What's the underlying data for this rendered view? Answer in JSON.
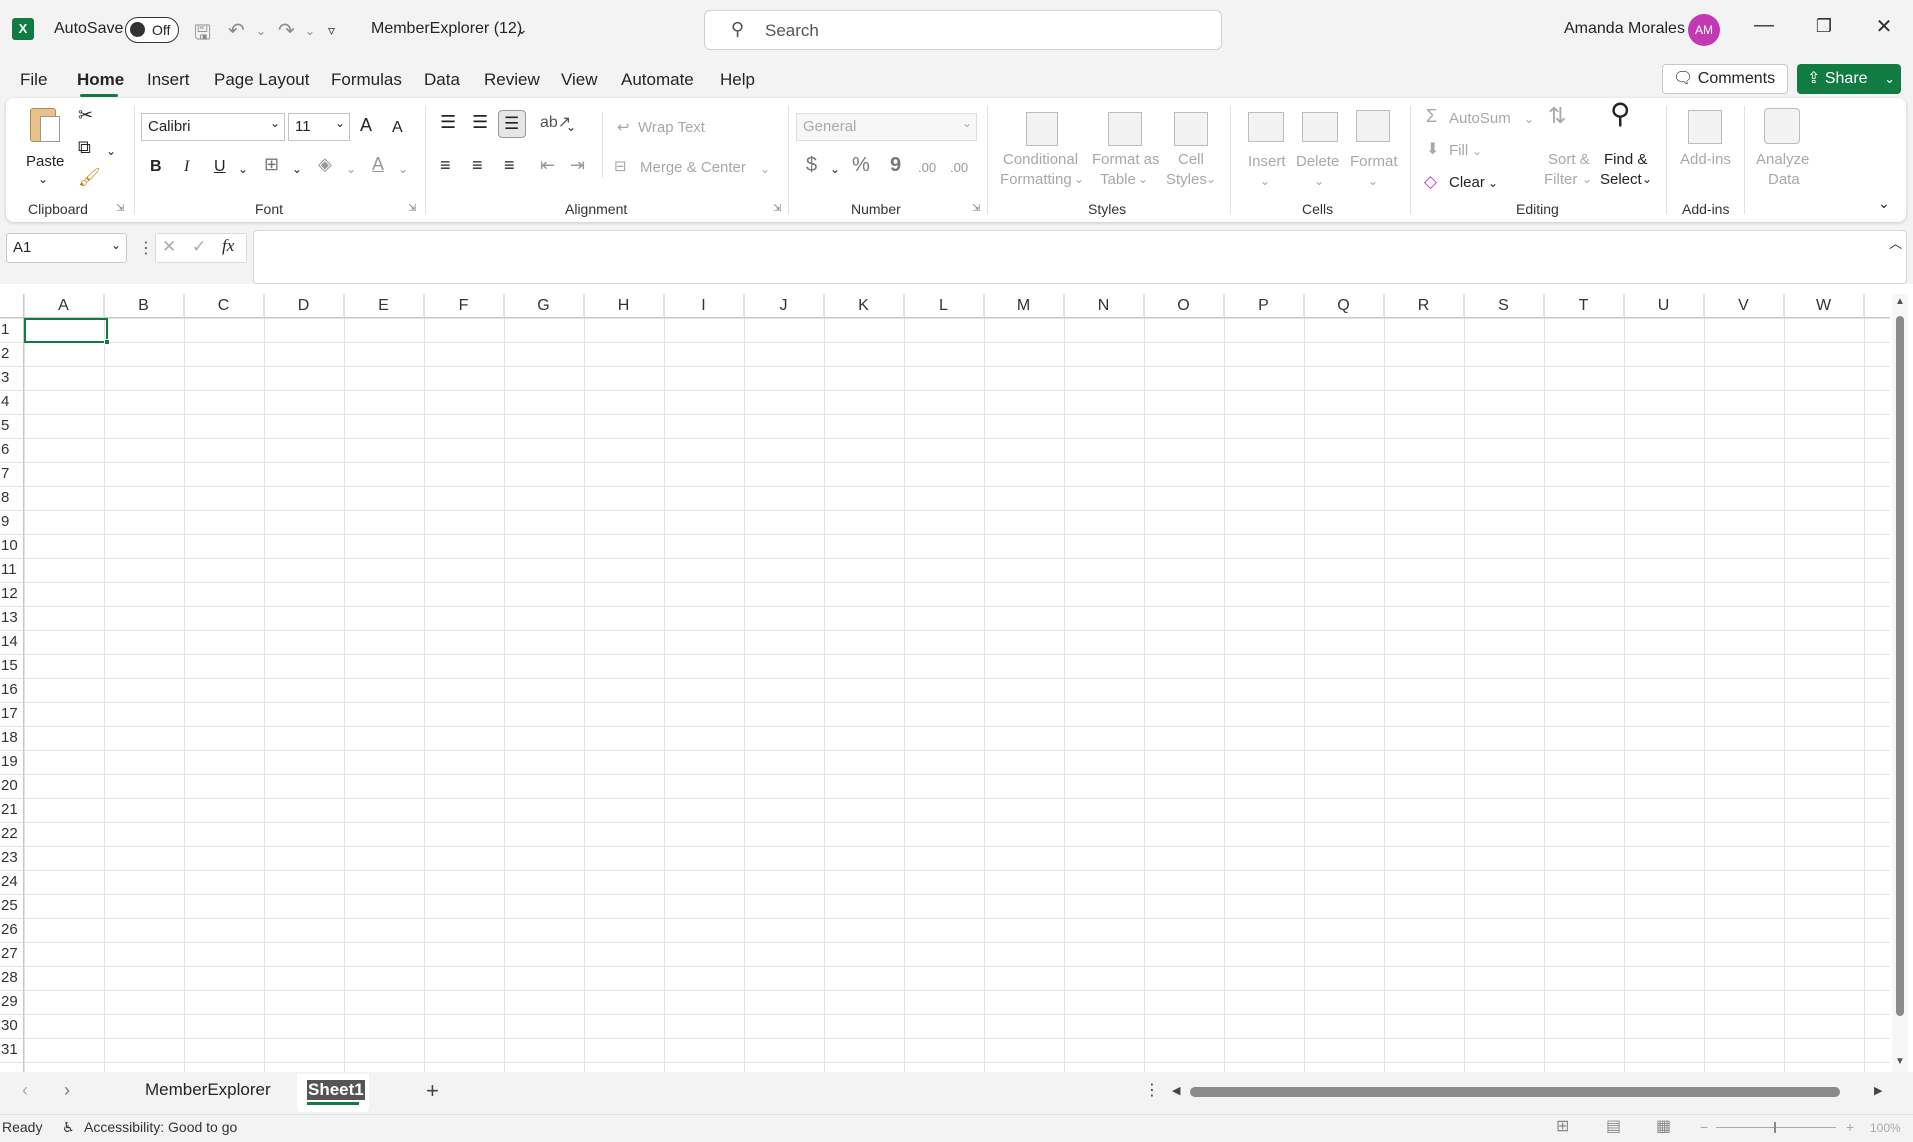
{
  "titlebar": {
    "autosave_label": "AutoSave",
    "autosave_state": "Off",
    "filename": "MemberExplorer (12)",
    "search_placeholder": "Search",
    "user_name": "Amanda Morales",
    "user_initials": "AM"
  },
  "tabs": [
    "File",
    "Home",
    "Insert",
    "Page Layout",
    "Formulas",
    "Data",
    "Review",
    "View",
    "Automate",
    "Help"
  ],
  "active_tab": "Home",
  "actions": {
    "comments": "Comments",
    "share": "Share"
  },
  "ribbon": {
    "clipboard": {
      "paste": "Paste",
      "group": "Clipboard"
    },
    "font": {
      "name": "Calibri",
      "size": "11",
      "group": "Font",
      "bold": "B",
      "italic": "I",
      "underline": "U",
      "grow": "A",
      "shrink": "A"
    },
    "alignment": {
      "wrap": "Wrap Text",
      "merge": "Merge & Center",
      "group": "Alignment"
    },
    "number": {
      "format": "General",
      "group": "Number",
      "currency": "$",
      "percent": "%",
      "comma": "9",
      "inc_dec": ".00",
      "dec_dec": ".00"
    },
    "styles": {
      "cond1": "Conditional",
      "cond2": "Formatting",
      "fmt1": "Format as",
      "fmt2": "Table",
      "cell1": "Cell",
      "cell2": "Styles",
      "group": "Styles"
    },
    "cells": {
      "insert": "Insert",
      "delete": "Delete",
      "format": "Format",
      "group": "Cells"
    },
    "editing": {
      "autosum": "AutoSum",
      "fill": "Fill",
      "clear": "Clear",
      "sort1": "Sort &",
      "sort2": "Filter",
      "find1": "Find &",
      "find2": "Select",
      "group": "Editing"
    },
    "addins": {
      "addins": "Add-ins",
      "analyze1": "Analyze",
      "analyze2": "Data",
      "group": "Add-ins"
    }
  },
  "formula_bar": {
    "name_box": "A1",
    "fx": "fx",
    "value": ""
  },
  "grid": {
    "columns": [
      "A",
      "B",
      "C",
      "D",
      "E",
      "F",
      "G",
      "H",
      "I",
      "J",
      "K",
      "L",
      "M",
      "N",
      "O",
      "P",
      "Q",
      "R",
      "S",
      "T",
      "U",
      "V",
      "W"
    ],
    "rows": [
      "1",
      "2",
      "3",
      "4",
      "5",
      "6",
      "7",
      "8",
      "9",
      "10",
      "11",
      "12",
      "13",
      "14",
      "15",
      "16",
      "17",
      "18",
      "19",
      "20",
      "21",
      "22",
      "23",
      "24",
      "25",
      "26",
      "27",
      "28",
      "29",
      "30",
      "31"
    ],
    "selected_cell": "A1"
  },
  "sheets": {
    "tabs": [
      "MemberExplorer",
      "Sheet1"
    ],
    "active": "Sheet1"
  },
  "status": {
    "ready": "Ready",
    "accessibility": "Accessibility: Good to go",
    "zoom": "100%"
  },
  "colors": {
    "accent": "#107c41",
    "avatar": "#c239b3"
  }
}
